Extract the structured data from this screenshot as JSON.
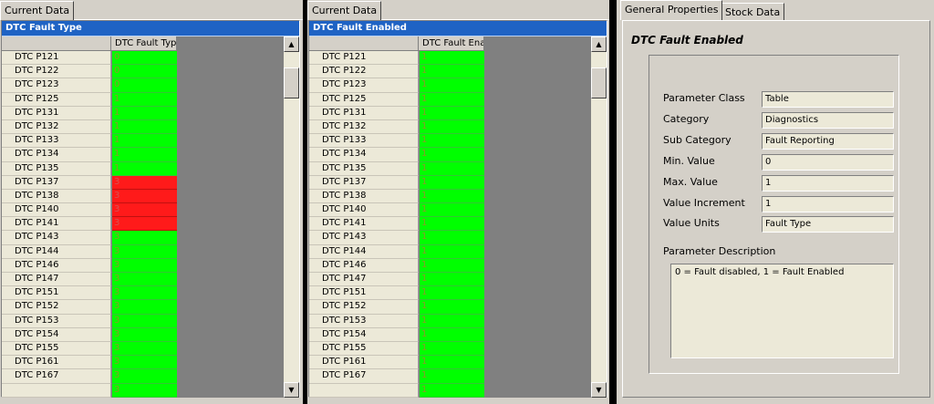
{
  "colors": {
    "titlebar": "#1f63c4",
    "ok_cell": "#00ff00",
    "fault_cell": "#ff1a1a",
    "panel": "#d4d0c8"
  },
  "left_panel": {
    "tab_label": "Current Data",
    "title": "DTC Fault Type",
    "column_header": "DTC Fault Type",
    "rows": [
      {
        "label": "DTC P121",
        "value": "0",
        "status": "ok"
      },
      {
        "label": "DTC P122",
        "value": "0",
        "status": "ok"
      },
      {
        "label": "DTC P123",
        "value": "0",
        "status": "ok"
      },
      {
        "label": "DTC P125",
        "value": "1",
        "status": "ok"
      },
      {
        "label": "DTC P131",
        "value": "1",
        "status": "ok"
      },
      {
        "label": "DTC P132",
        "value": "1",
        "status": "ok"
      },
      {
        "label": "DTC P133",
        "value": "1",
        "status": "ok"
      },
      {
        "label": "DTC P134",
        "value": "1",
        "status": "ok"
      },
      {
        "label": "DTC P135",
        "value": "1",
        "status": "ok"
      },
      {
        "label": "DTC P137",
        "value": "3",
        "status": "fault"
      },
      {
        "label": "DTC P138",
        "value": "3",
        "status": "fault"
      },
      {
        "label": "DTC P140",
        "value": "3",
        "status": "fault"
      },
      {
        "label": "DTC P141",
        "value": "3",
        "status": "fault"
      },
      {
        "label": "DTC P143",
        "value": "3",
        "status": "ok"
      },
      {
        "label": "DTC P144",
        "value": "3",
        "status": "ok"
      },
      {
        "label": "DTC P146",
        "value": "3",
        "status": "ok"
      },
      {
        "label": "DTC P147",
        "value": "3",
        "status": "ok"
      },
      {
        "label": "DTC P151",
        "value": "3",
        "status": "ok"
      },
      {
        "label": "DTC P152",
        "value": "3",
        "status": "ok"
      },
      {
        "label": "DTC P153",
        "value": "3",
        "status": "ok"
      },
      {
        "label": "DTC P154",
        "value": "3",
        "status": "ok"
      },
      {
        "label": "DTC P155",
        "value": "3",
        "status": "ok"
      },
      {
        "label": "DTC P161",
        "value": "3",
        "status": "ok"
      },
      {
        "label": "DTC P167",
        "value": "3",
        "status": "ok"
      },
      {
        "label": "",
        "value": "3",
        "status": "ok"
      }
    ]
  },
  "middle_panel": {
    "tab_label": "Current Data",
    "title": "DTC Fault Enabled",
    "column_header": "DTC Fault Enal",
    "rows": [
      {
        "label": "DTC P121",
        "value": "1",
        "status": "ok"
      },
      {
        "label": "DTC P122",
        "value": "1",
        "status": "ok"
      },
      {
        "label": "DTC P123",
        "value": "1",
        "status": "ok"
      },
      {
        "label": "DTC P125",
        "value": "1",
        "status": "ok"
      },
      {
        "label": "DTC P131",
        "value": "1",
        "status": "ok"
      },
      {
        "label": "DTC P132",
        "value": "1",
        "status": "ok"
      },
      {
        "label": "DTC P133",
        "value": "1",
        "status": "ok"
      },
      {
        "label": "DTC P134",
        "value": "1",
        "status": "ok"
      },
      {
        "label": "DTC P135",
        "value": "1",
        "status": "ok"
      },
      {
        "label": "DTC P137",
        "value": "1",
        "status": "ok"
      },
      {
        "label": "DTC P138",
        "value": "1",
        "status": "ok"
      },
      {
        "label": "DTC P140",
        "value": "1",
        "status": "ok"
      },
      {
        "label": "DTC P141",
        "value": "1",
        "status": "ok"
      },
      {
        "label": "DTC P143",
        "value": "1",
        "status": "ok"
      },
      {
        "label": "DTC P144",
        "value": "1",
        "status": "ok"
      },
      {
        "label": "DTC P146",
        "value": "1",
        "status": "ok"
      },
      {
        "label": "DTC P147",
        "value": "1",
        "status": "ok"
      },
      {
        "label": "DTC P151",
        "value": "1",
        "status": "ok"
      },
      {
        "label": "DTC P152",
        "value": "1",
        "status": "ok"
      },
      {
        "label": "DTC P153",
        "value": "1",
        "status": "ok"
      },
      {
        "label": "DTC P154",
        "value": "1",
        "status": "ok"
      },
      {
        "label": "DTC P155",
        "value": "1",
        "status": "ok"
      },
      {
        "label": "DTC P161",
        "value": "1",
        "status": "ok"
      },
      {
        "label": "DTC P167",
        "value": "1",
        "status": "ok"
      },
      {
        "label": "",
        "value": "1",
        "status": "ok"
      }
    ]
  },
  "right_panel": {
    "tabs": [
      {
        "label": "General Properties",
        "active": true
      },
      {
        "label": "Stock Data",
        "active": false
      }
    ],
    "title": "DTC Fault Enabled",
    "properties": [
      {
        "label": "Parameter Class",
        "value": "Table"
      },
      {
        "label": "Category",
        "value": "Diagnostics"
      },
      {
        "label": "Sub Category",
        "value": "Fault Reporting"
      },
      {
        "label": "Min. Value",
        "value": "0"
      },
      {
        "label": "Max. Value",
        "value": "1"
      },
      {
        "label": "Value Increment",
        "value": "1"
      },
      {
        "label": "Value Units",
        "value": "Fault Type"
      }
    ],
    "description_label": "Parameter Description",
    "description": "0 = Fault disabled, 1 = Fault Enabled"
  },
  "icons": {
    "scroll_up": "scroll-up-arrow-icon",
    "scroll_down": "scroll-down-arrow-icon"
  }
}
